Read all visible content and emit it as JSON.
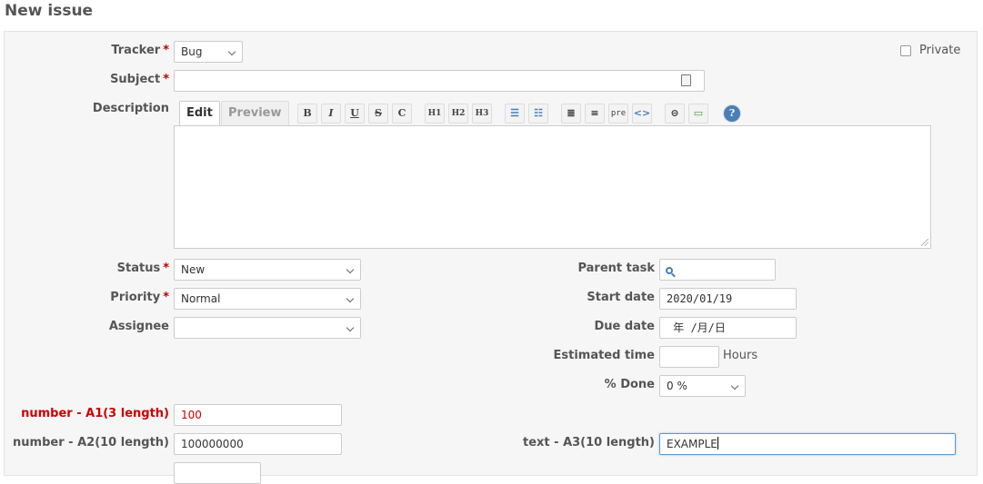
{
  "page": {
    "title": "New issue"
  },
  "form": {
    "tracker": {
      "label": "Tracker",
      "value": "Bug"
    },
    "private_label": "Private",
    "subject": {
      "label": "Subject",
      "value": ""
    },
    "description": {
      "label": "Description"
    },
    "tabs": {
      "edit": "Edit",
      "preview": "Preview"
    },
    "toolbar": [
      {
        "name": "bold",
        "glyph": "B"
      },
      {
        "name": "italic",
        "glyph": "I"
      },
      {
        "name": "underline",
        "glyph": "U"
      },
      {
        "name": "strikethrough",
        "glyph": "S"
      },
      {
        "name": "code",
        "glyph": "C"
      },
      {
        "name": "heading-1",
        "glyph": "H1"
      },
      {
        "name": "heading-2",
        "glyph": "H2"
      },
      {
        "name": "heading-3",
        "glyph": "H3"
      },
      {
        "name": "unordered-list",
        "glyph": "☰"
      },
      {
        "name": "ordered-list",
        "glyph": "☷"
      },
      {
        "name": "quote",
        "glyph": "≣"
      },
      {
        "name": "unquote",
        "glyph": "≡"
      },
      {
        "name": "preformatted",
        "glyph": "pre"
      },
      {
        "name": "highlighted-code",
        "glyph": "<>"
      },
      {
        "name": "link",
        "glyph": "⊝"
      },
      {
        "name": "image",
        "glyph": "▭"
      },
      {
        "name": "help",
        "glyph": "?"
      }
    ],
    "status": {
      "label": "Status",
      "value": "New"
    },
    "priority": {
      "label": "Priority",
      "value": "Normal"
    },
    "assignee": {
      "label": "Assignee",
      "value": ""
    },
    "parent_task": {
      "label": "Parent task"
    },
    "start_date": {
      "label": "Start date",
      "value": "2020/01/19"
    },
    "due_date": {
      "label": "Due date",
      "value": " 年 /月/日"
    },
    "estimated_time": {
      "label": "Estimated time",
      "unit": "Hours",
      "value": ""
    },
    "done": {
      "label": "% Done",
      "value": "0 %"
    },
    "number_a1": {
      "label": "number - A1(3 length)",
      "value": "100"
    },
    "number_a2": {
      "label": "number - A2(10 length)",
      "value": "100000000"
    },
    "text_a3": {
      "label": "text - A3(10 length)",
      "value": "EXAMPLE"
    }
  }
}
